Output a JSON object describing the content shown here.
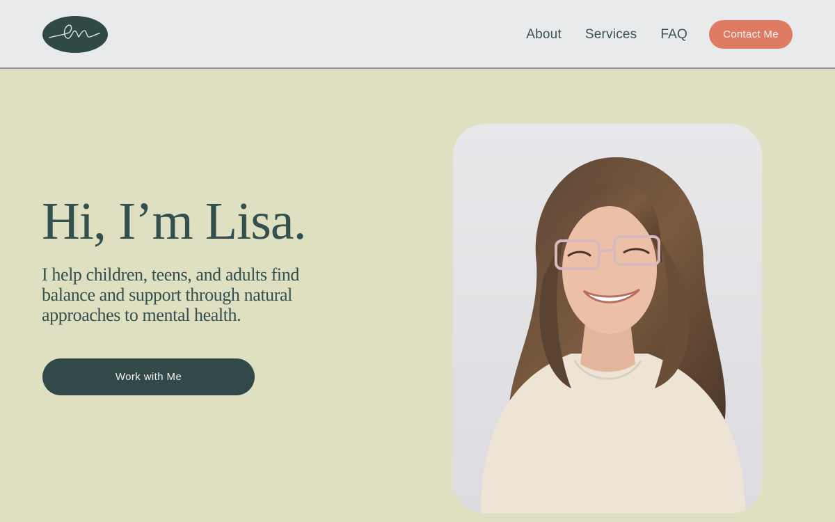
{
  "header": {
    "logo_alt": "lr",
    "nav": {
      "about": "About",
      "services": "Services",
      "faq": "FAQ",
      "contact": "Contact Me"
    }
  },
  "hero": {
    "title": "Hi, I’m Lisa.",
    "subtitle": "I help children, teens, and adults find balance and support through natural approaches to mental health.",
    "cta": "Work with Me"
  },
  "colors": {
    "page_bg": "#dfe0c2",
    "header_bg": "#e9eaec",
    "text_dark": "#34504e",
    "accent": "#e07b63",
    "button_dark": "#32494a"
  }
}
